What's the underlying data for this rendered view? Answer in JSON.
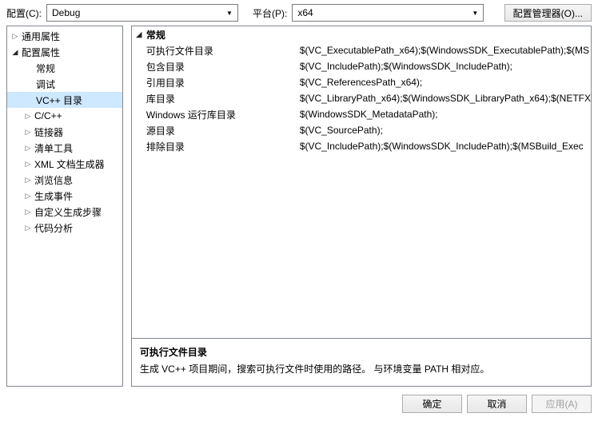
{
  "topbar": {
    "config_label": "配置(C):",
    "config_value": "Debug",
    "platform_label": "平台(P):",
    "platform_value": "x64",
    "config_manager": "配置管理器(O)..."
  },
  "tree": {
    "common_properties": "通用属性",
    "config_properties": "配置属性",
    "general": "常规",
    "debug": "调试",
    "vcpp_dirs": "VC++ 目录",
    "ccpp": "C/C++",
    "linker": "链接器",
    "manifest_tool": "清单工具",
    "xml_doc_gen": "XML 文档生成器",
    "browse_info": "浏览信息",
    "build_events": "生成事件",
    "custom_build_step": "自定义生成步骤",
    "code_analysis": "代码分析"
  },
  "props": {
    "category": "常规",
    "rows": [
      {
        "label": "可执行文件目录",
        "value": "$(VC_ExecutablePath_x64);$(WindowsSDK_ExecutablePath);$(MS"
      },
      {
        "label": "包含目录",
        "value": "$(VC_IncludePath);$(WindowsSDK_IncludePath);"
      },
      {
        "label": "引用目录",
        "value": "$(VC_ReferencesPath_x64);"
      },
      {
        "label": "库目录",
        "value": "$(VC_LibraryPath_x64);$(WindowsSDK_LibraryPath_x64);$(NETFX"
      },
      {
        "label": "Windows 运行库目录",
        "value": "$(WindowsSDK_MetadataPath);"
      },
      {
        "label": "源目录",
        "value": "$(VC_SourcePath);"
      },
      {
        "label": "排除目录",
        "value": "$(VC_IncludePath);$(WindowsSDK_IncludePath);$(MSBuild_Exec"
      }
    ]
  },
  "description": {
    "title": "可执行文件目录",
    "text": "生成 VC++ 项目期间，搜索可执行文件时使用的路径。  与环境变量 PATH 相对应。"
  },
  "buttons": {
    "ok": "确定",
    "cancel": "取消",
    "apply": "应用(A)"
  }
}
